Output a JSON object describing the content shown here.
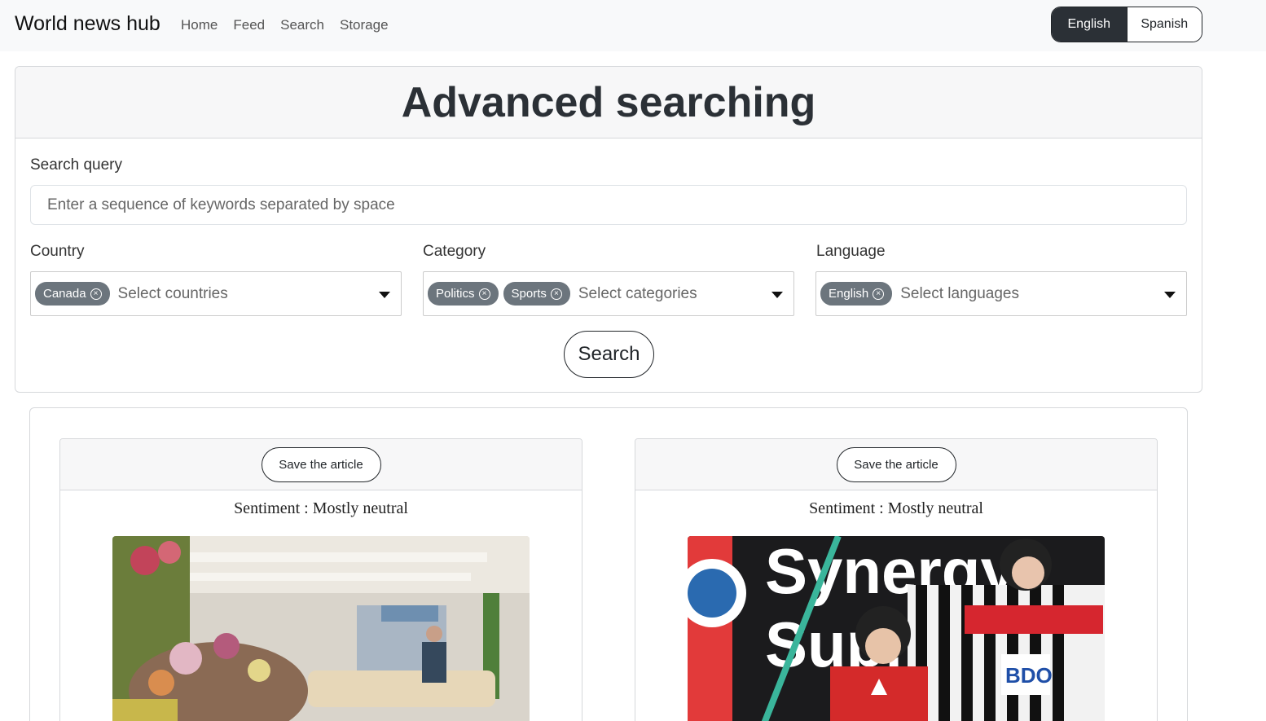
{
  "navbar": {
    "brand": "World news hub",
    "links": [
      "Home",
      "Feed",
      "Search",
      "Storage"
    ],
    "languages": {
      "active": "English",
      "inactive": "Spanish"
    }
  },
  "search": {
    "title": "Advanced searching",
    "query_label": "Search query",
    "query_placeholder": "Enter a sequence of keywords separated by space",
    "query_value": "",
    "country": {
      "label": "Country",
      "chips": [
        "Canada"
      ],
      "placeholder": "Select countries"
    },
    "category": {
      "label": "Category",
      "chips": [
        "Politics",
        "Sports"
      ],
      "placeholder": "Select categories"
    },
    "language": {
      "label": "Language",
      "chips": [
        "English"
      ],
      "placeholder": "Select languages"
    },
    "button_label": "Search"
  },
  "results": {
    "articles": [
      {
        "save_label": "Save the article",
        "sentiment": "Sentiment : Mostly neutral"
      },
      {
        "save_label": "Save the article",
        "sentiment": "Sentiment : Mostly neutral"
      }
    ]
  },
  "colors": {
    "navbar_bg": "#f8f9fa",
    "dark": "#2b3036",
    "chip": "#6c757d",
    "card_header": "#f7f7f8"
  }
}
